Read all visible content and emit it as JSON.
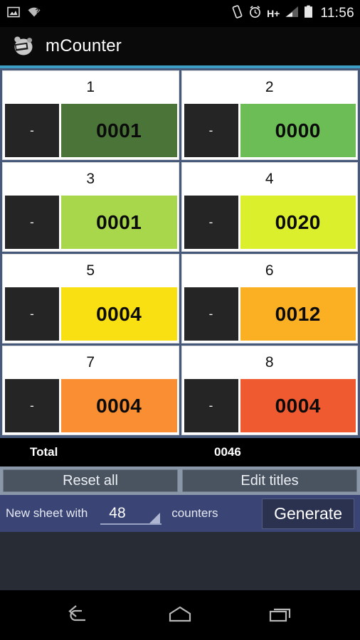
{
  "statusbar": {
    "icons_left": [
      "image-icon",
      "wifi-question-icon"
    ],
    "icons_right": [
      "vibrate-icon",
      "alarm-icon",
      "hplus-icon",
      "signal-icon",
      "battery-icon"
    ],
    "network_label": "H+",
    "clock": "11:56"
  },
  "actionbar": {
    "icon": "mcounter-app-icon",
    "title": "mCounter",
    "accent_color": "#3d9ec4"
  },
  "counters": [
    {
      "title": "1",
      "value": "0001",
      "color": "#4a7438",
      "minus": "-"
    },
    {
      "title": "2",
      "value": "0000",
      "color": "#6cbd55",
      "minus": "-"
    },
    {
      "title": "3",
      "value": "0001",
      "color": "#a8d74c",
      "minus": "-"
    },
    {
      "title": "4",
      "value": "0020",
      "color": "#dbef2c",
      "minus": "-"
    },
    {
      "title": "5",
      "value": "0004",
      "color": "#f8e013",
      "minus": "-"
    },
    {
      "title": "6",
      "value": "0012",
      "color": "#fbaf23",
      "minus": "-"
    },
    {
      "title": "7",
      "value": "0004",
      "color": "#f98f32",
      "minus": "-"
    },
    {
      "title": "8",
      "value": "0004",
      "color": "#f05a31",
      "minus": "-"
    }
  ],
  "total": {
    "label": "Total",
    "value": "0046"
  },
  "buttons": {
    "reset_all": "Reset all",
    "edit_titles": "Edit titles"
  },
  "generator": {
    "prefix_label": "New sheet with",
    "count_value": "48",
    "suffix_label": "counters",
    "generate_label": "Generate"
  },
  "navbar": {
    "back": "back-icon",
    "home": "home-icon",
    "recents": "recents-icon"
  }
}
